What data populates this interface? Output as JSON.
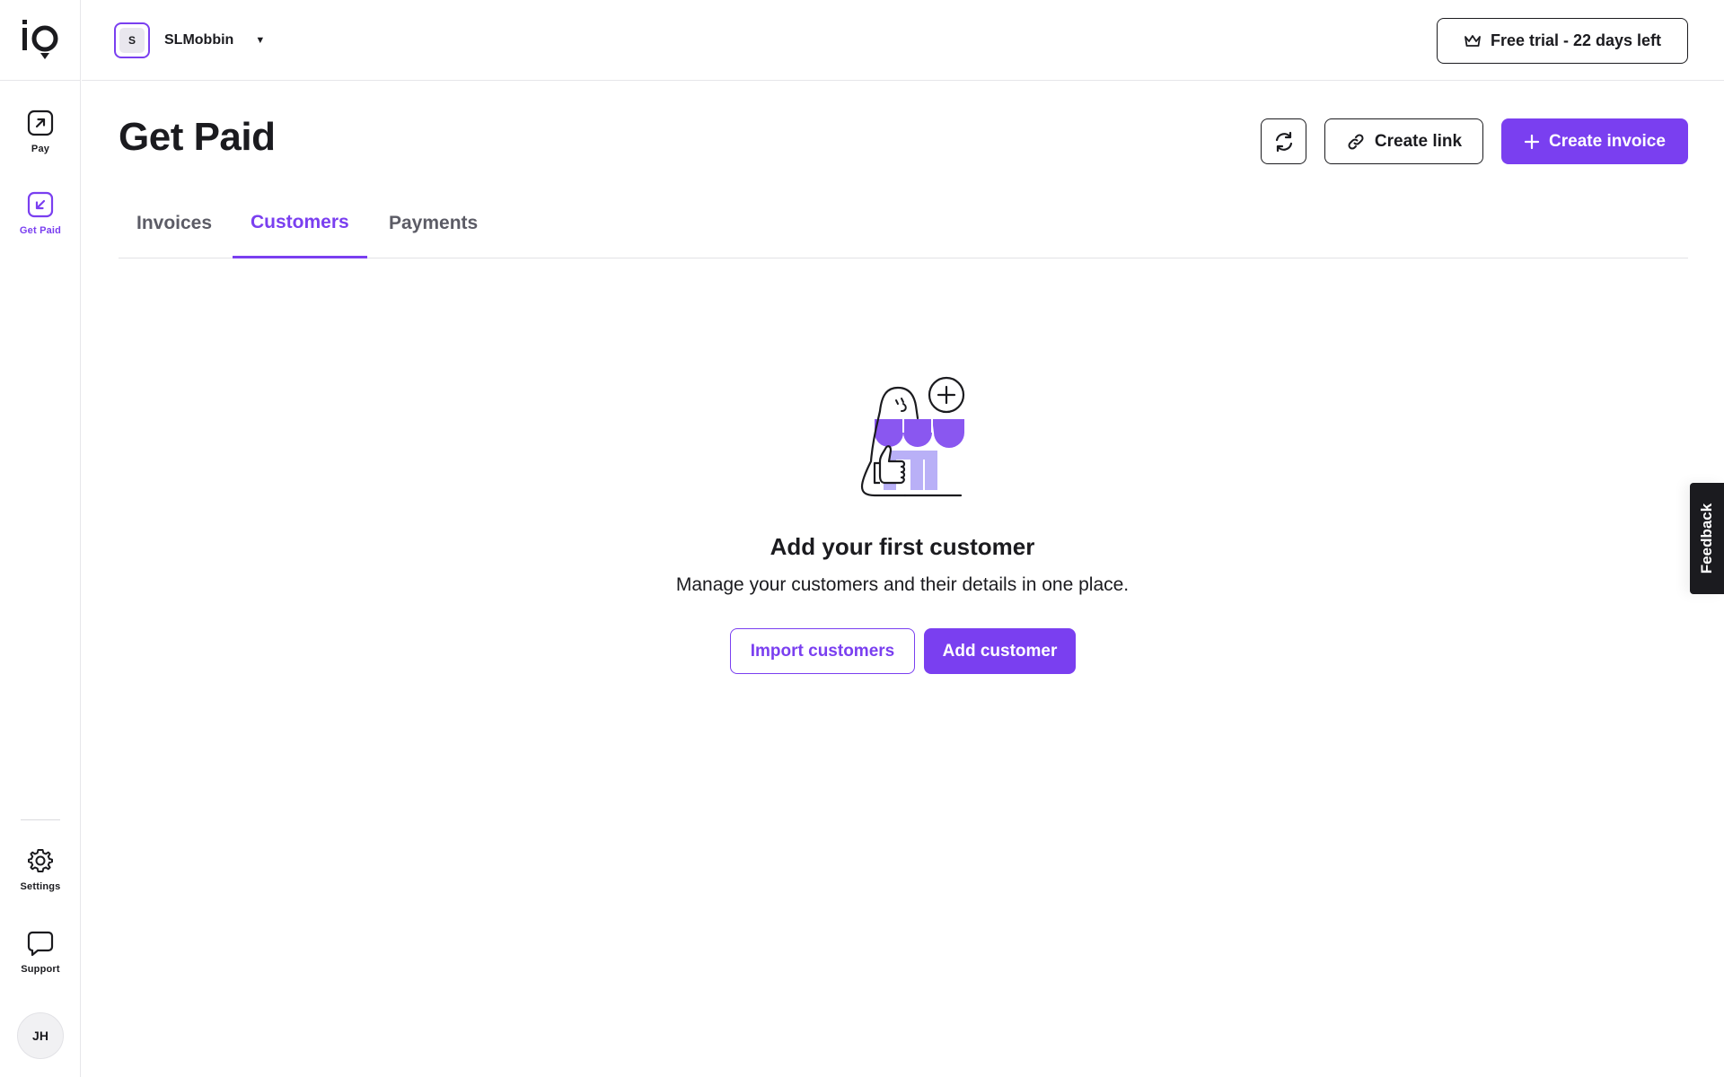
{
  "sidebar": {
    "logo_text": "io",
    "items": [
      {
        "label": "Pay",
        "icon": "arrow-up-right-icon"
      },
      {
        "label": "Get Paid",
        "icon": "arrow-down-left-icon"
      }
    ],
    "bottom_items": [
      {
        "label": "Settings",
        "icon": "gear-icon"
      },
      {
        "label": "Support",
        "icon": "chat-bubble-icon"
      }
    ],
    "avatar_initials": "JH"
  },
  "topbar": {
    "org_initial": "S",
    "org_name": "SLMobbin",
    "trial_label": "Free trial - 22 days left"
  },
  "page": {
    "title": "Get Paid",
    "create_link_label": "Create link",
    "create_invoice_label": "Create invoice"
  },
  "tabs": [
    {
      "label": "Invoices",
      "active": false
    },
    {
      "label": "Customers",
      "active": true
    },
    {
      "label": "Payments",
      "active": false
    }
  ],
  "empty_state": {
    "title": "Add your first customer",
    "subtitle": "Manage your customers and their details in one place.",
    "import_label": "Import customers",
    "add_label": "Add customer"
  },
  "feedback_label": "Feedback",
  "colors": {
    "accent": "#7a3ff0",
    "accent_light": "#b9b0f7",
    "text": "#1b1b1f",
    "border": "#e6e6ea"
  }
}
